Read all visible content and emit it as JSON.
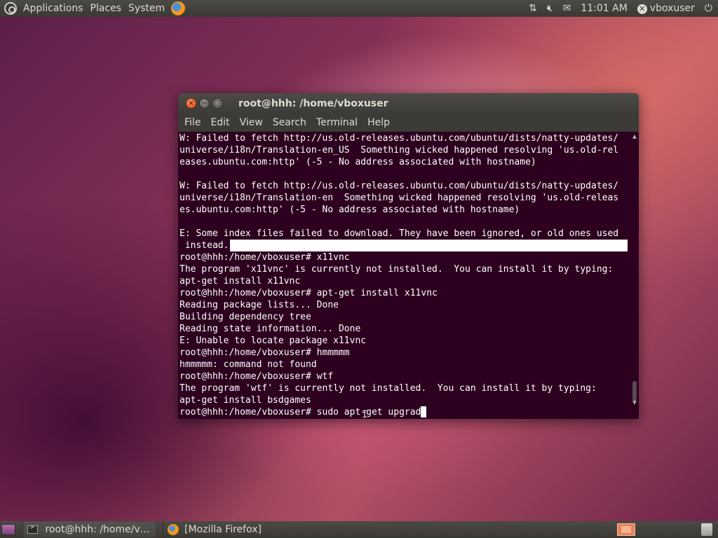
{
  "top_panel": {
    "menus": [
      "Applications",
      "Places",
      "System"
    ],
    "clock": "11:01 AM",
    "username": "vboxuser",
    "icons": [
      "ubuntu-logo-icon",
      "firefox-icon",
      "network-updown-icon",
      "volume-muted-icon",
      "mail-icon",
      "user-status-icon",
      "power-icon"
    ]
  },
  "terminal": {
    "title": "root@hhh: /home/vboxuser",
    "menu": [
      "File",
      "Edit",
      "View",
      "Search",
      "Terminal",
      "Help"
    ],
    "lines": [
      "W: Failed to fetch http://us.old-releases.ubuntu.com/ubuntu/dists/natty-updates/",
      "universe/i18n/Translation-en_US  Something wicked happened resolving 'us.old-rel",
      "eases.ubuntu.com:http' (-5 - No address associated with hostname)",
      "",
      "W: Failed to fetch http://us.old-releases.ubuntu.com/ubuntu/dists/natty-updates/",
      "universe/i18n/Translation-en  Something wicked happened resolving 'us.old-releas",
      "es.ubuntu.com:http' (-5 - No address associated with hostname)",
      "",
      "E: Some index files failed to download. They have been ignored, or old ones used",
      " instead.",
      "root@hhh:/home/vboxuser# x11vnc",
      "The program 'x11vnc' is currently not installed.  You can install it by typing:",
      "apt-get install x11vnc",
      "root@hhh:/home/vboxuser# apt-get install x11vnc",
      "Reading package lists... Done",
      "Building dependency tree",
      "Reading state information... Done",
      "E: Unable to locate package x11vnc",
      "root@hhh:/home/vboxuser# hmmmmm",
      "hmmmmm: command not found",
      "root@hhh:/home/vboxuser# wtf",
      "The program 'wtf' is currently not installed.  You can install it by typing:",
      "apt-get install bsdgames"
    ],
    "prompt": "root@hhh:/home/vboxuser# ",
    "input": "sudo apt-get upgrad"
  },
  "taskbar": {
    "tasks": [
      "root@hhh: /home/vb...",
      "[Mozilla Firefox]"
    ]
  },
  "colors": {
    "terminal_bg": "#2c001e",
    "panel_bg": "#3c3b37",
    "close_button": "#df4a14"
  }
}
